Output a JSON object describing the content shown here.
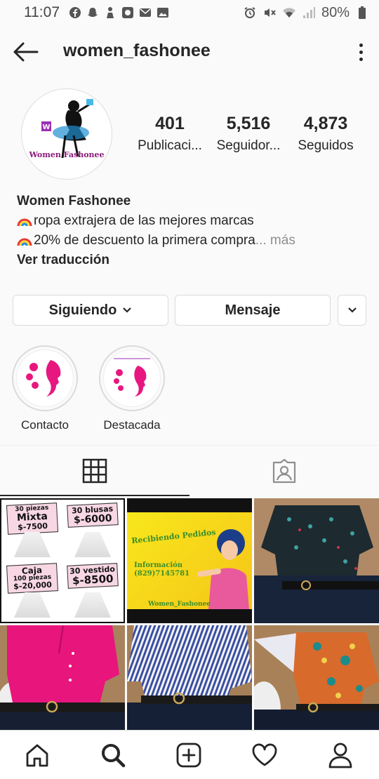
{
  "status_bar": {
    "time": "11:07",
    "battery": "80%"
  },
  "header": {
    "username": "women_fashonee"
  },
  "profile": {
    "avatar_brand": "Women Fashonee",
    "stats": [
      {
        "value": "401",
        "label": "Publicaci..."
      },
      {
        "value": "5,516",
        "label": "Seguidor..."
      },
      {
        "value": "4,873",
        "label": "Seguidos"
      }
    ],
    "name": "Women Fashonee",
    "bio_line1": "ropa extrajera de las mejores marcas",
    "bio_line2": "20% de descuento la primera compra",
    "bio_ellipsis": "...",
    "more": "más",
    "translate": "Ver traducción"
  },
  "actions": {
    "follow": "Siguiendo",
    "message": "Mensaje"
  },
  "highlights": [
    {
      "label": "Contacto"
    },
    {
      "label": "Destacada"
    }
  ],
  "posts": {
    "promo": {
      "cards": [
        {
          "line1": "30 piezas",
          "line2": "Mixta",
          "line3": "$-7500"
        },
        {
          "line1": "30 blusas",
          "line2": "$-6000",
          "line3": ""
        },
        {
          "line1": "Caja",
          "line2": "100 piezas",
          "line3": "$-20,000"
        },
        {
          "line1": "30 vestido",
          "line2": "$-8500",
          "line3": ""
        }
      ]
    },
    "flyer": {
      "title": "Recibiendo Pedidos",
      "info1": "Información",
      "info2": "(829)7145781",
      "brand": "Women_Fashonee"
    }
  },
  "colors": {
    "accent": "#262626",
    "muted": "#8e8e8e",
    "border": "#dbdbdb",
    "pink": "#e8177f"
  }
}
